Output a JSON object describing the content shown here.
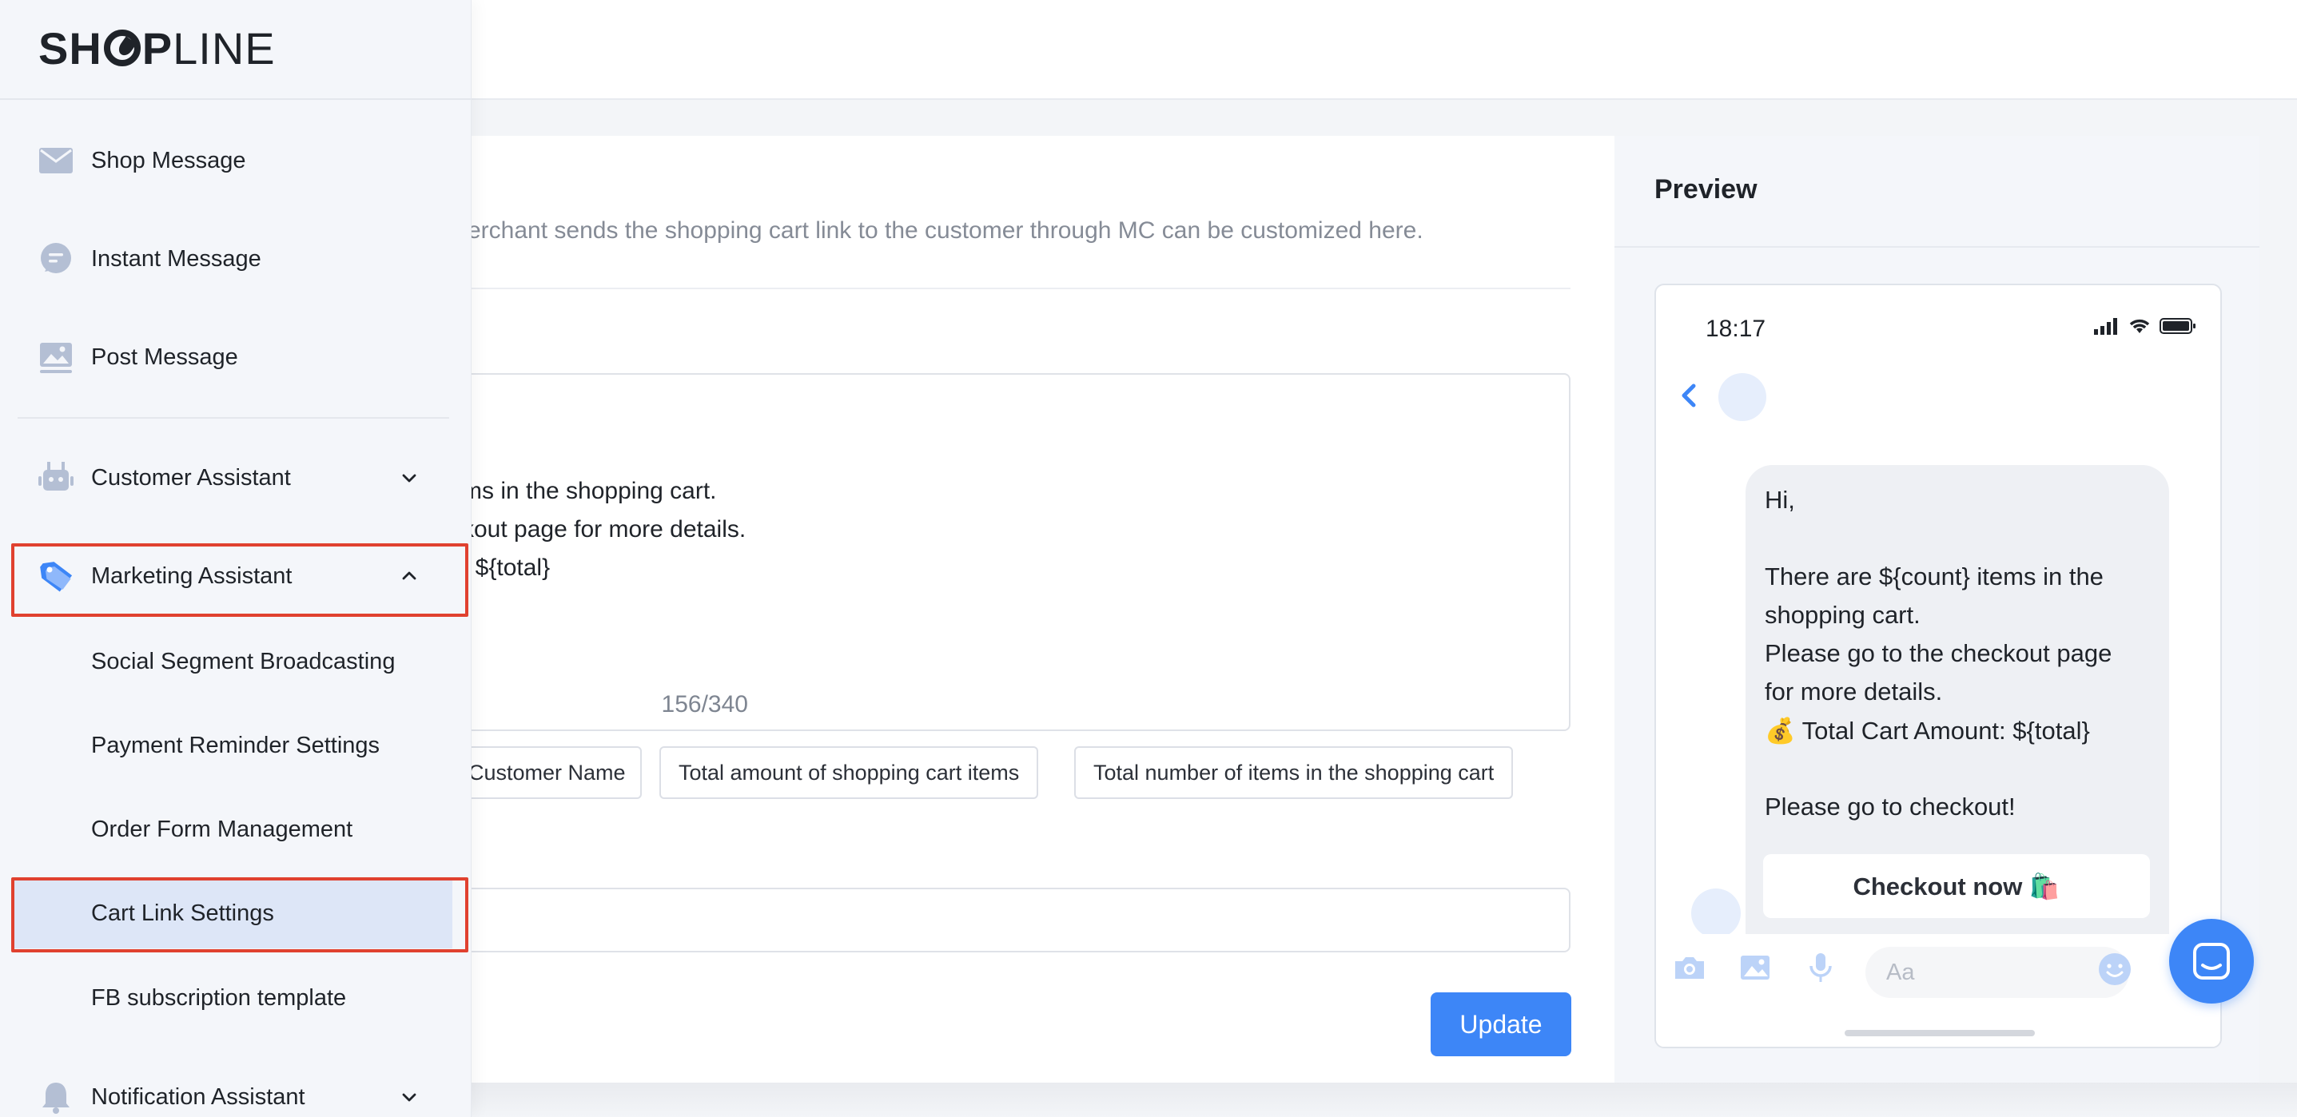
{
  "brand": {
    "logo_text_bold": "SH",
    "logo_text_bold2": "P",
    "logo_text_light": "LINE"
  },
  "sidebar": {
    "items": [
      {
        "label": "Shop Message",
        "icon": "mail-icon"
      },
      {
        "label": "Instant Message",
        "icon": "chat-bubble-icon"
      },
      {
        "label": "Post Message",
        "icon": "image-icon"
      },
      {
        "label": "Customer Assistant",
        "icon": "robot-icon",
        "expanded": false
      },
      {
        "label": "Marketing Assistant",
        "icon": "price-tag-icon",
        "expanded": true
      },
      {
        "label": "Notification Assistant",
        "icon": "bell-icon",
        "expanded": false
      }
    ],
    "marketing_sub": [
      {
        "label": "Social Segment Broadcasting"
      },
      {
        "label": "Payment Reminder Settings"
      },
      {
        "label": "Order Form Management"
      },
      {
        "label": "Cart Link Settings",
        "active": true
      },
      {
        "label": "FB subscription template"
      }
    ],
    "accent_color": "#3d86f7",
    "highlight_color": "#e0412f"
  },
  "main": {
    "description": "erchant sends the shopping cart link to the customer through MC can be customized here.",
    "template_lines": [
      "ms in the shopping cart.",
      "kout page for more details.",
      ": ${total}",
      "!"
    ],
    "char_count": "156/340",
    "variable_tags": [
      "Customer Name",
      "Total amount of shopping cart items",
      "Total number of items in the shopping cart"
    ],
    "update_label": "Update"
  },
  "preview": {
    "title": "Preview",
    "time": "18:17",
    "message_lines": [
      "Hi,",
      "",
      "There are ${count} items in the",
      "shopping cart.",
      "Please go to the checkout page",
      "for more details.",
      "💰 Total Cart Amount: ${total}",
      "",
      "Please go to checkout!"
    ],
    "checkout_button": "Checkout now 🛍️",
    "input_placeholder": "Aa"
  }
}
